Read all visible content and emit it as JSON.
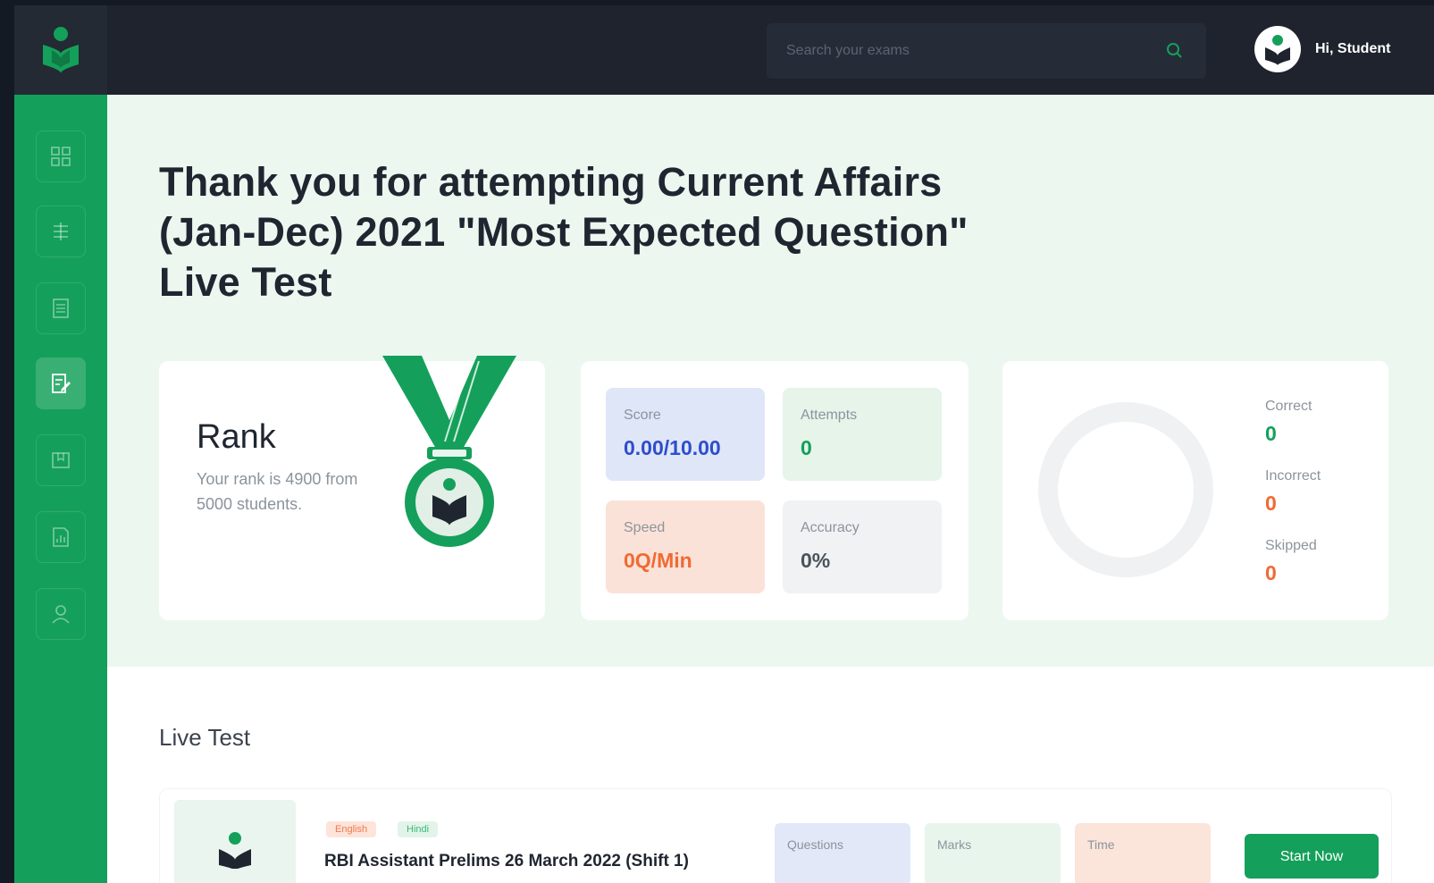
{
  "header": {
    "search_placeholder": "Search your exams",
    "greeting": "Hi, Student"
  },
  "sidebar": {
    "items": [
      {
        "icon": "dashboard-icon",
        "active": false
      },
      {
        "icon": "exams-icon",
        "active": false
      },
      {
        "icon": "notes-icon",
        "active": false
      },
      {
        "icon": "test-icon",
        "active": true
      },
      {
        "icon": "bookmark-icon",
        "active": false
      },
      {
        "icon": "report-icon",
        "active": false
      },
      {
        "icon": "profile-icon",
        "active": false
      }
    ]
  },
  "page": {
    "title": "Thank you for attempting Current Affairs (Jan-Dec) 2021 \"Most Expected Question\" Live Test"
  },
  "rank": {
    "title": "Rank",
    "text": "Your rank is 4900 from 5000 students."
  },
  "stats": {
    "score_label": "Score",
    "score_value": "0.00/10.00",
    "attempts_label": "Attempts",
    "attempts_value": "0",
    "speed_label": "Speed",
    "speed_value": "0Q/Min",
    "accuracy_label": "Accuracy",
    "accuracy_value": "0%"
  },
  "results": {
    "correct_label": "Correct",
    "correct_value": "0",
    "incorrect_label": "Incorrect",
    "incorrect_value": "0",
    "skipped_label": "Skipped",
    "skipped_value": "0"
  },
  "live_test": {
    "section_title": "Live Test",
    "tags": [
      "English",
      "Hindi"
    ],
    "name": "RBI Assistant Prelims 26 March 2022 (Shift 1)",
    "questions_label": "Questions",
    "marks_label": "Marks",
    "time_label": "Time",
    "button_label": "Start Now"
  },
  "colors": {
    "brand_green": "#14a05a",
    "topbar": "#1e232d",
    "hero_bg": "#ecf7f0",
    "score_blue": "#2e4dcc",
    "speed_orange": "#f06a33"
  }
}
